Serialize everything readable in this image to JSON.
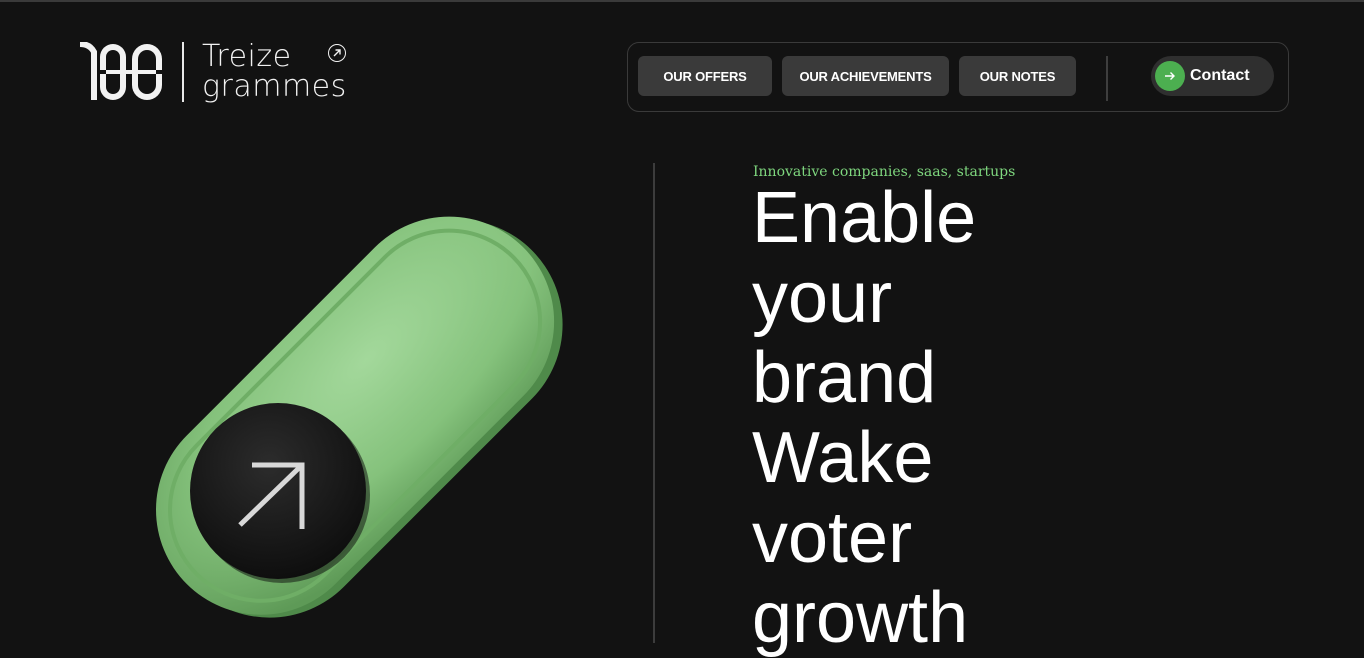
{
  "brand": {
    "name_line1": "Treize",
    "name_line2": "grammes",
    "mark_icon": "logo-100-mark",
    "link_icon": "arrow-up-right-circle-icon"
  },
  "nav": {
    "items": [
      {
        "label": "OUR OFFERS"
      },
      {
        "label": "OUR ACHIEVEMENTS"
      },
      {
        "label": "OUR NOTES"
      }
    ],
    "contact": {
      "label": "Contact",
      "icon": "arrow-right-icon"
    }
  },
  "hero": {
    "eyebrow": "Innovative companies, saas, startups",
    "lines": [
      "Enable",
      "your",
      "brand",
      "Wake",
      "voter",
      "growth"
    ],
    "illustration": "green-toggle-switch-with-arrow"
  },
  "colors": {
    "background": "#121212",
    "button_bg": "#3a3a3a",
    "accent_green": "#4caf50",
    "eyebrow_green": "#7ed67e",
    "toggle_green": "#8fcb86"
  }
}
